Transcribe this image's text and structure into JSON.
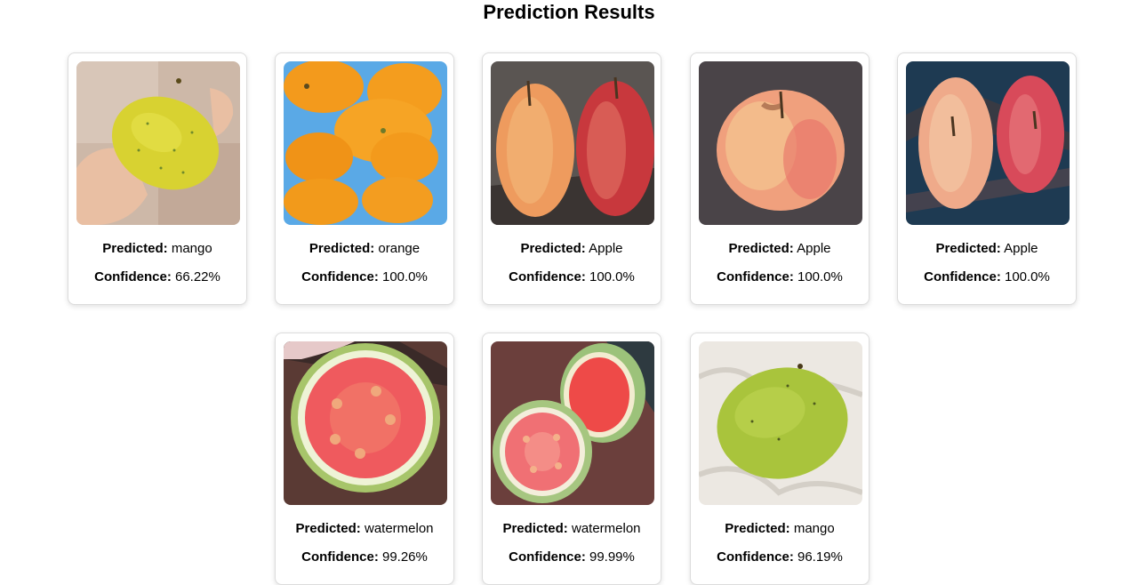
{
  "page": {
    "title": "Prediction Results"
  },
  "labels": {
    "predicted": "Predicted:",
    "confidence": "Confidence:"
  },
  "results": [
    {
      "fruit": "mango",
      "confidence": "66.22%"
    },
    {
      "fruit": "orange",
      "confidence": "100.0%"
    },
    {
      "fruit": "Apple",
      "confidence": "100.0%"
    },
    {
      "fruit": "Apple",
      "confidence": "100.0%"
    },
    {
      "fruit": "Apple",
      "confidence": "100.0%"
    },
    {
      "fruit": "watermelon",
      "confidence": "99.26%"
    },
    {
      "fruit": "watermelon",
      "confidence": "99.99%"
    },
    {
      "fruit": "mango",
      "confidence": "96.19%"
    }
  ]
}
